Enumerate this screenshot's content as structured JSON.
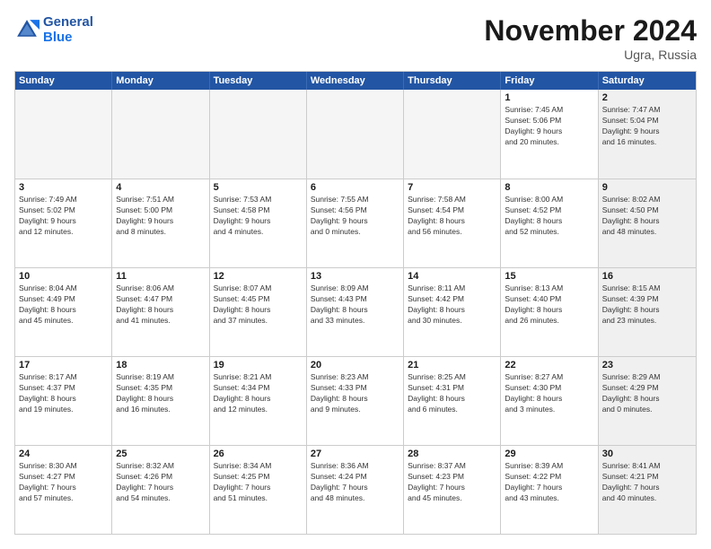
{
  "logo": {
    "line1": "General",
    "line2": "Blue"
  },
  "title": "November 2024",
  "location": "Ugra, Russia",
  "header_days": [
    "Sunday",
    "Monday",
    "Tuesday",
    "Wednesday",
    "Thursday",
    "Friday",
    "Saturday"
  ],
  "weeks": [
    [
      {
        "day": "",
        "info": "",
        "shaded": true
      },
      {
        "day": "",
        "info": "",
        "shaded": true
      },
      {
        "day": "",
        "info": "",
        "shaded": true
      },
      {
        "day": "",
        "info": "",
        "shaded": true
      },
      {
        "day": "",
        "info": "",
        "shaded": true
      },
      {
        "day": "1",
        "info": "Sunrise: 7:45 AM\nSunset: 5:06 PM\nDaylight: 9 hours\nand 20 minutes.",
        "shaded": false
      },
      {
        "day": "2",
        "info": "Sunrise: 7:47 AM\nSunset: 5:04 PM\nDaylight: 9 hours\nand 16 minutes.",
        "shaded": true
      }
    ],
    [
      {
        "day": "3",
        "info": "Sunrise: 7:49 AM\nSunset: 5:02 PM\nDaylight: 9 hours\nand 12 minutes.",
        "shaded": false
      },
      {
        "day": "4",
        "info": "Sunrise: 7:51 AM\nSunset: 5:00 PM\nDaylight: 9 hours\nand 8 minutes.",
        "shaded": false
      },
      {
        "day": "5",
        "info": "Sunrise: 7:53 AM\nSunset: 4:58 PM\nDaylight: 9 hours\nand 4 minutes.",
        "shaded": false
      },
      {
        "day": "6",
        "info": "Sunrise: 7:55 AM\nSunset: 4:56 PM\nDaylight: 9 hours\nand 0 minutes.",
        "shaded": false
      },
      {
        "day": "7",
        "info": "Sunrise: 7:58 AM\nSunset: 4:54 PM\nDaylight: 8 hours\nand 56 minutes.",
        "shaded": false
      },
      {
        "day": "8",
        "info": "Sunrise: 8:00 AM\nSunset: 4:52 PM\nDaylight: 8 hours\nand 52 minutes.",
        "shaded": false
      },
      {
        "day": "9",
        "info": "Sunrise: 8:02 AM\nSunset: 4:50 PM\nDaylight: 8 hours\nand 48 minutes.",
        "shaded": true
      }
    ],
    [
      {
        "day": "10",
        "info": "Sunrise: 8:04 AM\nSunset: 4:49 PM\nDaylight: 8 hours\nand 45 minutes.",
        "shaded": false
      },
      {
        "day": "11",
        "info": "Sunrise: 8:06 AM\nSunset: 4:47 PM\nDaylight: 8 hours\nand 41 minutes.",
        "shaded": false
      },
      {
        "day": "12",
        "info": "Sunrise: 8:07 AM\nSunset: 4:45 PM\nDaylight: 8 hours\nand 37 minutes.",
        "shaded": false
      },
      {
        "day": "13",
        "info": "Sunrise: 8:09 AM\nSunset: 4:43 PM\nDaylight: 8 hours\nand 33 minutes.",
        "shaded": false
      },
      {
        "day": "14",
        "info": "Sunrise: 8:11 AM\nSunset: 4:42 PM\nDaylight: 8 hours\nand 30 minutes.",
        "shaded": false
      },
      {
        "day": "15",
        "info": "Sunrise: 8:13 AM\nSunset: 4:40 PM\nDaylight: 8 hours\nand 26 minutes.",
        "shaded": false
      },
      {
        "day": "16",
        "info": "Sunrise: 8:15 AM\nSunset: 4:39 PM\nDaylight: 8 hours\nand 23 minutes.",
        "shaded": true
      }
    ],
    [
      {
        "day": "17",
        "info": "Sunrise: 8:17 AM\nSunset: 4:37 PM\nDaylight: 8 hours\nand 19 minutes.",
        "shaded": false
      },
      {
        "day": "18",
        "info": "Sunrise: 8:19 AM\nSunset: 4:35 PM\nDaylight: 8 hours\nand 16 minutes.",
        "shaded": false
      },
      {
        "day": "19",
        "info": "Sunrise: 8:21 AM\nSunset: 4:34 PM\nDaylight: 8 hours\nand 12 minutes.",
        "shaded": false
      },
      {
        "day": "20",
        "info": "Sunrise: 8:23 AM\nSunset: 4:33 PM\nDaylight: 8 hours\nand 9 minutes.",
        "shaded": false
      },
      {
        "day": "21",
        "info": "Sunrise: 8:25 AM\nSunset: 4:31 PM\nDaylight: 8 hours\nand 6 minutes.",
        "shaded": false
      },
      {
        "day": "22",
        "info": "Sunrise: 8:27 AM\nSunset: 4:30 PM\nDaylight: 8 hours\nand 3 minutes.",
        "shaded": false
      },
      {
        "day": "23",
        "info": "Sunrise: 8:29 AM\nSunset: 4:29 PM\nDaylight: 8 hours\nand 0 minutes.",
        "shaded": true
      }
    ],
    [
      {
        "day": "24",
        "info": "Sunrise: 8:30 AM\nSunset: 4:27 PM\nDaylight: 7 hours\nand 57 minutes.",
        "shaded": false
      },
      {
        "day": "25",
        "info": "Sunrise: 8:32 AM\nSunset: 4:26 PM\nDaylight: 7 hours\nand 54 minutes.",
        "shaded": false
      },
      {
        "day": "26",
        "info": "Sunrise: 8:34 AM\nSunset: 4:25 PM\nDaylight: 7 hours\nand 51 minutes.",
        "shaded": false
      },
      {
        "day": "27",
        "info": "Sunrise: 8:36 AM\nSunset: 4:24 PM\nDaylight: 7 hours\nand 48 minutes.",
        "shaded": false
      },
      {
        "day": "28",
        "info": "Sunrise: 8:37 AM\nSunset: 4:23 PM\nDaylight: 7 hours\nand 45 minutes.",
        "shaded": false
      },
      {
        "day": "29",
        "info": "Sunrise: 8:39 AM\nSunset: 4:22 PM\nDaylight: 7 hours\nand 43 minutes.",
        "shaded": false
      },
      {
        "day": "30",
        "info": "Sunrise: 8:41 AM\nSunset: 4:21 PM\nDaylight: 7 hours\nand 40 minutes.",
        "shaded": true
      }
    ]
  ]
}
